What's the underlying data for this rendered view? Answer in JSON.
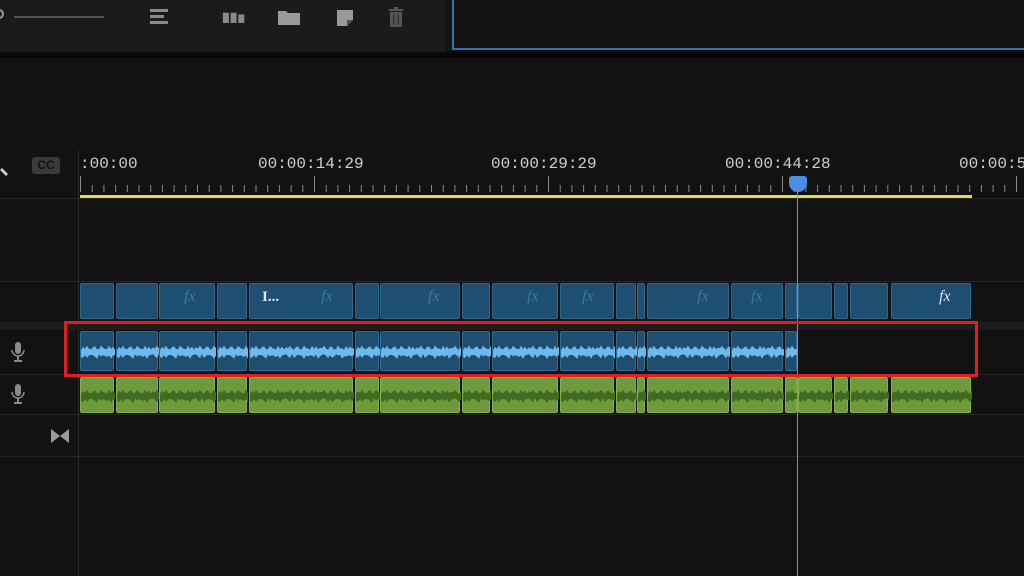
{
  "toolbar": {
    "icons": [
      "zoom-slider",
      "list-icon",
      "bin-icon",
      "folder-icon",
      "new-item-icon",
      "trash-icon"
    ]
  },
  "timeline": {
    "cc_label": "CC",
    "ruler_labels": [
      ":00:00",
      "00:00:14:29",
      "00:00:29:29",
      "00:00:44:28",
      "00:00:5"
    ],
    "clip_title": "I...",
    "fx_label": "fx"
  },
  "colors": {
    "video_clip": "#1f4f70",
    "audio_clip": "#1f4f70",
    "audio_clip_green": "#6e9a3c",
    "playhead": "#4a8fe0",
    "work_area_bar": "#e3d94a",
    "highlight_box": "#e02020"
  }
}
